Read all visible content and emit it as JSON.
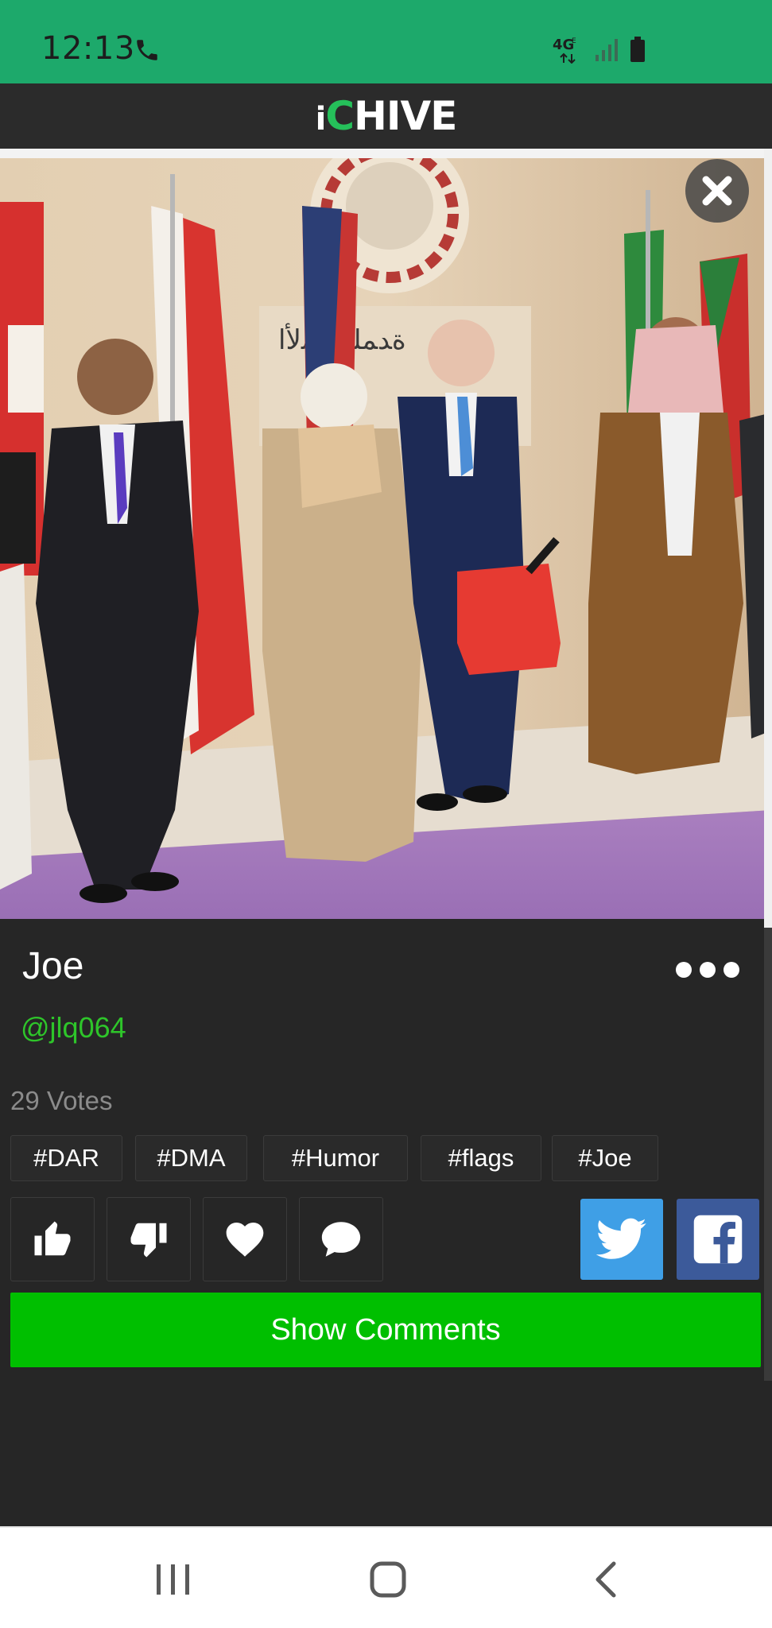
{
  "status_bar": {
    "time": "12:13",
    "network": "4G",
    "icons": [
      "phone-call-icon",
      "network-4g-icon",
      "signal-icon",
      "battery-icon"
    ],
    "bg_color": "#1da96b"
  },
  "header": {
    "logo_prefix": "i",
    "logo_c": "C",
    "logo_rest": "HIVE",
    "accent_color": "#25c05a"
  },
  "post": {
    "title": "Joe",
    "username": "@jlq064",
    "votes": "29 Votes",
    "tags": [
      "#DAR",
      "#DMA",
      "#Humor",
      "#flags",
      "#Joe"
    ]
  },
  "actions": {
    "icons": [
      "thumbs-up-icon",
      "thumbs-down-icon",
      "heart-icon",
      "comment-icon"
    ],
    "share": [
      "twitter-icon",
      "facebook-icon"
    ]
  },
  "show_comments_label": "Show Comments",
  "nav": {
    "icons": [
      "recent-apps-icon",
      "home-icon",
      "back-icon"
    ]
  }
}
